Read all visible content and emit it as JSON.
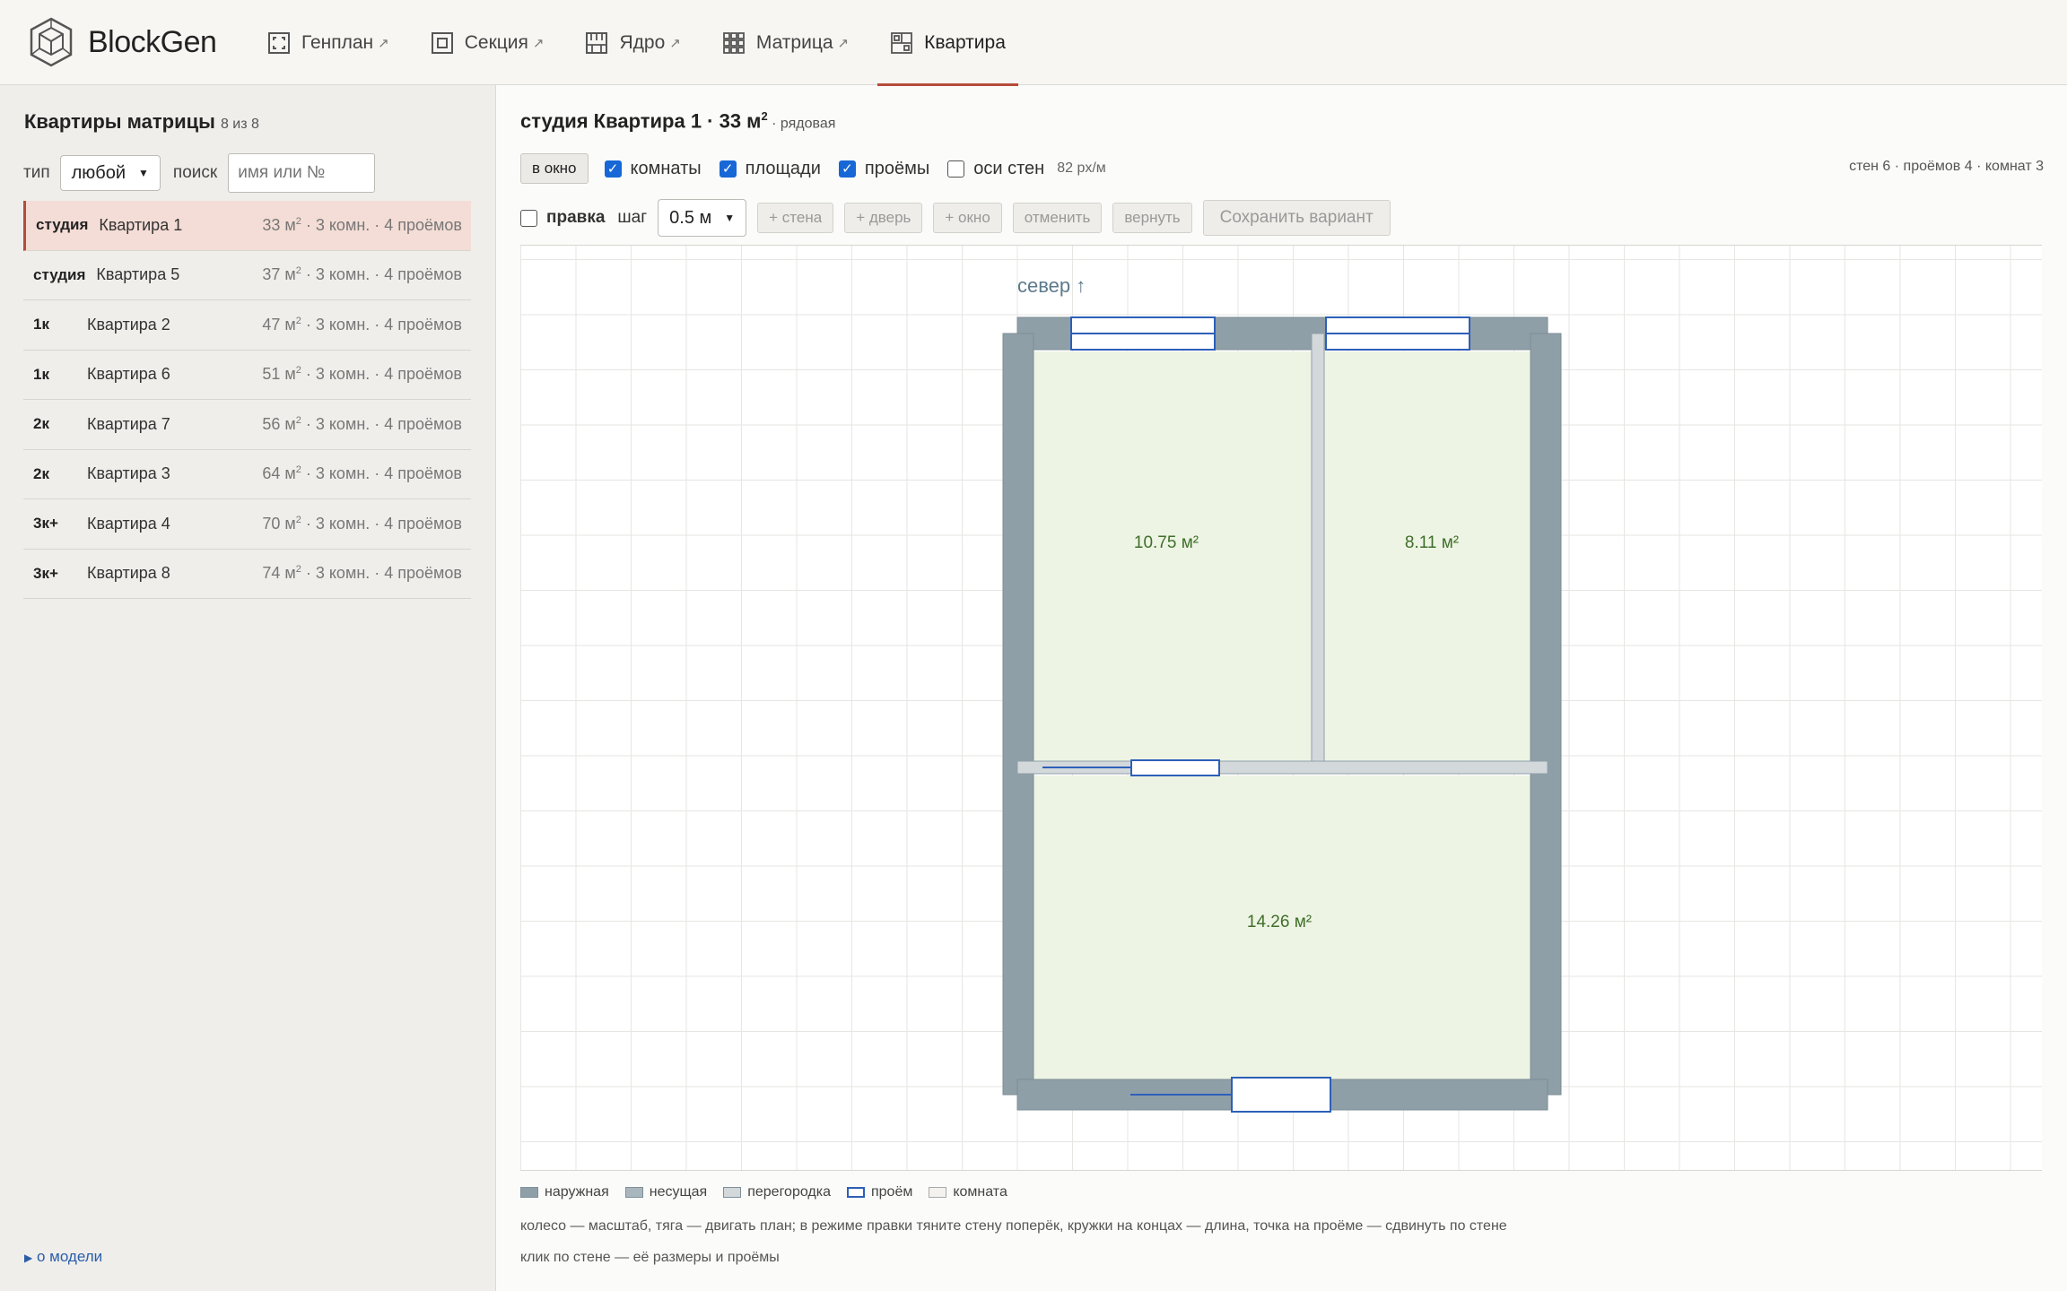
{
  "app": {
    "name": "BlockGen"
  },
  "nav": [
    {
      "label": "Генплан",
      "ext": "↗",
      "icon": "site-plan-icon"
    },
    {
      "label": "Секция",
      "ext": "↗",
      "icon": "section-icon"
    },
    {
      "label": "Ядро",
      "ext": "↗",
      "icon": "core-icon"
    },
    {
      "label": "Матрица",
      "ext": "↗",
      "icon": "matrix-icon"
    },
    {
      "label": "Квартира",
      "ext": "",
      "icon": "apartment-icon",
      "active": true
    }
  ],
  "sidebar": {
    "title": "Квартиры матрицы",
    "count": "8 из 8",
    "type_label": "тип",
    "type_value": "любой",
    "search_label": "поиск",
    "search_placeholder": "имя или №",
    "items": [
      {
        "type": "студия",
        "name": "Квартира 1",
        "area": "33 м",
        "info": " · 3 комн. · 4 проёмов",
        "selected": true
      },
      {
        "type": "студия",
        "name": "Квартира 5",
        "area": "37 м",
        "info": " · 3 комн. · 4 проёмов"
      },
      {
        "type": "1к",
        "name": "Квартира 2",
        "area": "47 м",
        "info": " · 3 комн. · 4 проёмов"
      },
      {
        "type": "1к",
        "name": "Квартира 6",
        "area": "51 м",
        "info": " · 3 комн. · 4 проёмов"
      },
      {
        "type": "2к",
        "name": "Квартира 7",
        "area": "56 м",
        "info": " · 3 комн. · 4 проёмов"
      },
      {
        "type": "2к",
        "name": "Квартира 3",
        "area": "64 м",
        "info": " · 3 комн. · 4 проёмов"
      },
      {
        "type": "3к+",
        "name": "Квартира 4",
        "area": "70 м",
        "info": " · 3 комн. · 4 проёмов"
      },
      {
        "type": "3к+",
        "name": "Квартира 8",
        "area": "74 м",
        "info": " · 3 комн. · 4 проёмов"
      }
    ],
    "about": "о модели"
  },
  "main": {
    "title": "студия Квартира 1 · 33 м",
    "title_sub": " · рядовая",
    "fit_button": "в окно",
    "cb_rooms": "комнаты",
    "cb_areas": "площади",
    "cb_openings": "проёмы",
    "cb_axes": "оси стен",
    "scale": "82 px/м",
    "stats": "стен 6 · проёмов 4 · комнат 3",
    "edit_label": "правка",
    "step_label": "шаг",
    "step_value": "0.5 м",
    "add_wall": "+ стена",
    "add_door": "+ дверь",
    "add_window": "+ окно",
    "undo": "отменить",
    "redo": "вернуть",
    "save": "Сохранить вариант"
  },
  "plan": {
    "north_label": "север ↑",
    "rooms": [
      {
        "area": "10.75 м²"
      },
      {
        "area": "8.11 м²"
      },
      {
        "area": "14.26 м²"
      }
    ]
  },
  "legend": {
    "outer": "наружная",
    "bearing": "несущая",
    "partition": "перегородка",
    "opening": "проём",
    "room": "комната"
  },
  "help": {
    "line1": "колесо — масштаб, тяга — двигать план; в режиме правки тяните стену поперёк, кружки на концах — длина, точка на проёме — сдвинуть по стене",
    "line2": "клик по стене — её размеры и проёмы"
  },
  "colors": {
    "accent": "#b64b3a",
    "wall": "#8f9fa8",
    "partition": "#d3d8db",
    "room": "#eef4e4",
    "opening": "#2d5fb8",
    "area_text": "#3f6f2a"
  }
}
